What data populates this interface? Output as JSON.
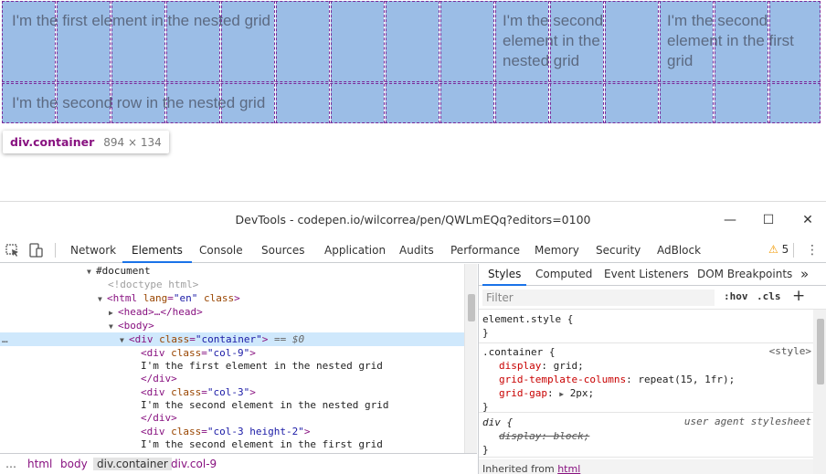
{
  "preview": {
    "text_first": "I'm the first element in the nested grid",
    "text_second_nested": "I'm the second element in the nested grid",
    "text_second_first": "I'm the second element in the first grid",
    "text_second_row": "I'm the second row in the nested grid",
    "tooltip_name": "div.container",
    "tooltip_size": "894 × 134"
  },
  "window": {
    "title": "DevTools - codepen.io/wilcorrea/pen/QWLmEQq?editors=0100",
    "minimize": "—",
    "maximize": "☐",
    "close": "✕"
  },
  "toolbar": {
    "tabs": [
      "Network",
      "Elements",
      "Console",
      "Sources",
      "Application",
      "Audits",
      "Performance",
      "Memory",
      "Security",
      "AdBlock"
    ],
    "active_tab": "Elements",
    "warning_count": "5",
    "more": "⋮"
  },
  "elements": {
    "doc": "#document",
    "doctype": "<!doctype html>",
    "html_open": "<html",
    "html_lang_attr": "lang",
    "html_lang_val": "\"en\"",
    "html_class_attr": "class",
    "html_close": ">",
    "head": "<head>…</head>",
    "body": "<body>",
    "container_open": "<div",
    "container_class_attr": "class",
    "container_class_val": "\"container\"",
    "container_close": ">",
    "container_marker": "== $0",
    "col9_open": "<div",
    "col9_attr": "class",
    "col9_val": "\"col-9\"",
    "col9_close": ">",
    "col9_text": "I'm the first element in the nested grid",
    "end_div_1": "</div>",
    "col3_open": "<div",
    "col3_attr": "class",
    "col3_val": "\"col-3\"",
    "col3_close": ">",
    "col3_text": "I'm the second element in the nested grid",
    "end_div_2": "</div>",
    "col3h_open": "<div",
    "col3h_attr": "class",
    "col3h_val": "\"col-3 height-2\"",
    "col3h_close": ">",
    "col3h_text": "I'm the second element in the first grid",
    "gutter": "…"
  },
  "breadcrumb": {
    "more": "…",
    "items": [
      "html",
      "body",
      "div.container",
      "div.col-9"
    ]
  },
  "styles": {
    "tabs": [
      "Styles",
      "Computed",
      "Event Listeners",
      "DOM Breakpoints"
    ],
    "more_tabs": "»",
    "filter_placeholder": "Filter",
    "hov": ":hov",
    "cls": ".cls",
    "plus": "+",
    "element_style_selector": "element.style {",
    "element_style_end": "}",
    "container_selector": ".container {",
    "container_source": "<style>",
    "p1_name": "display",
    "p1_value": "grid;",
    "p2_name": "grid-template-columns",
    "p2_value": "repeat(15, 1fr);",
    "p3_name": "grid-gap",
    "p3_value": "2px;",
    "container_end": "}",
    "div_selector": "div {",
    "div_source": "user agent stylesheet",
    "div_prop": "display: block;",
    "div_end": "}",
    "inherited_label": "Inherited from",
    "inherited_tag": "html"
  }
}
